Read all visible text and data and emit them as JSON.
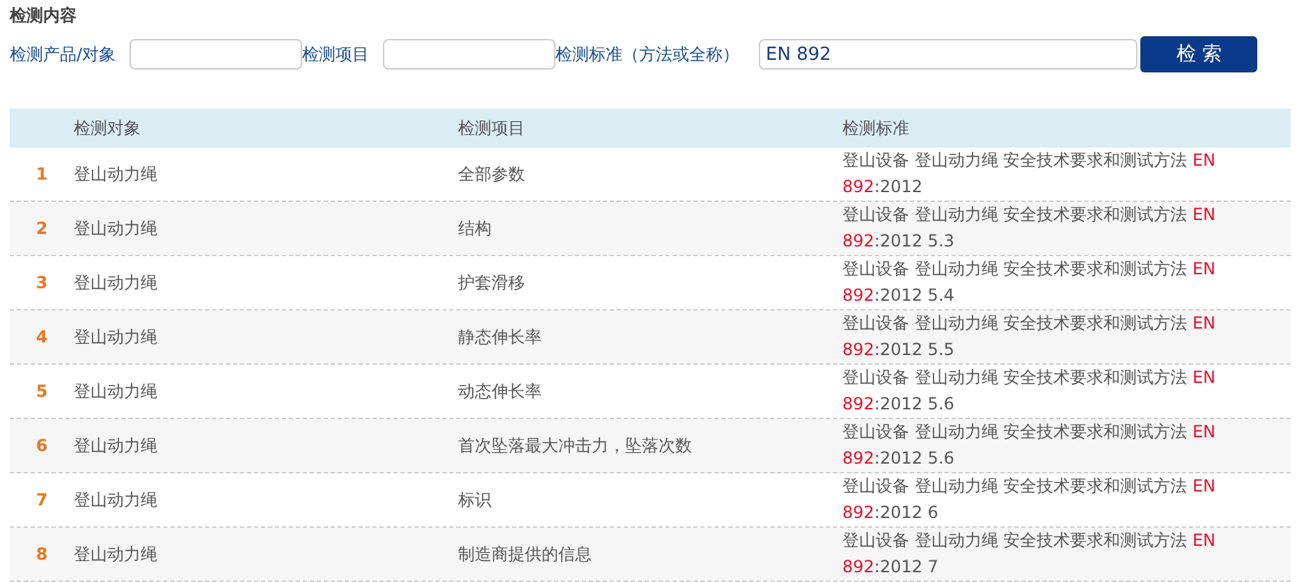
{
  "section_title": "检测内容",
  "search": {
    "fields": [
      {
        "label": "检测产品/对象"
      },
      {
        "label": "检测项目"
      },
      {
        "label": "检测标准（方法或全称）",
        "value": "EN 892"
      }
    ],
    "button": "检 索"
  },
  "table": {
    "columns": [
      "检测对象",
      "检测项目",
      "检测标准"
    ],
    "rows": [
      {
        "number": "1",
        "object": "登山动力绳",
        "item": "全部参数",
        "standard": {
          "before": "登山设备 登山动力绳 安全技术要求和测试方法 ",
          "match": "EN 892",
          "after": ":2012"
        }
      },
      {
        "number": "2",
        "object": "登山动力绳",
        "item": "结构",
        "standard": {
          "before": "登山设备 登山动力绳 安全技术要求和测试方法 ",
          "match": "EN 892",
          "after": ":2012 5.3"
        }
      },
      {
        "number": "3",
        "object": "登山动力绳",
        "item": "护套滑移",
        "standard": {
          "before": "登山设备 登山动力绳 安全技术要求和测试方法 ",
          "match": "EN 892",
          "after": ":2012 5.4"
        }
      },
      {
        "number": "4",
        "object": "登山动力绳",
        "item": "静态伸长率",
        "standard": {
          "before": "登山设备 登山动力绳 安全技术要求和测试方法 ",
          "match": "EN 892",
          "after": ":2012 5.5"
        }
      },
      {
        "number": "5",
        "object": "登山动力绳",
        "item": "动态伸长率",
        "standard": {
          "before": "登山设备 登山动力绳 安全技术要求和测试方法 ",
          "match": "EN 892",
          "after": ":2012 5.6"
        }
      },
      {
        "number": "6",
        "object": "登山动力绳",
        "item": "首次坠落最大冲击力，坠落次数",
        "standard": {
          "before": "登山设备 登山动力绳 安全技术要求和测试方法 ",
          "match": "EN 892",
          "after": ":2012 5.6"
        }
      },
      {
        "number": "7",
        "object": "登山动力绳",
        "item": "标识",
        "standard": {
          "before": "登山设备 登山动力绳 安全技术要求和测试方法 ",
          "match": "EN 892",
          "after": ":2012 6"
        }
      },
      {
        "number": "8",
        "object": "登山动力绳",
        "item": "制造商提供的信息",
        "standard": {
          "before": "登山设备 登山动力绳 安全技术要求和测试方法 ",
          "match": "EN 892",
          "after": ":2012 7"
        }
      }
    ]
  }
}
